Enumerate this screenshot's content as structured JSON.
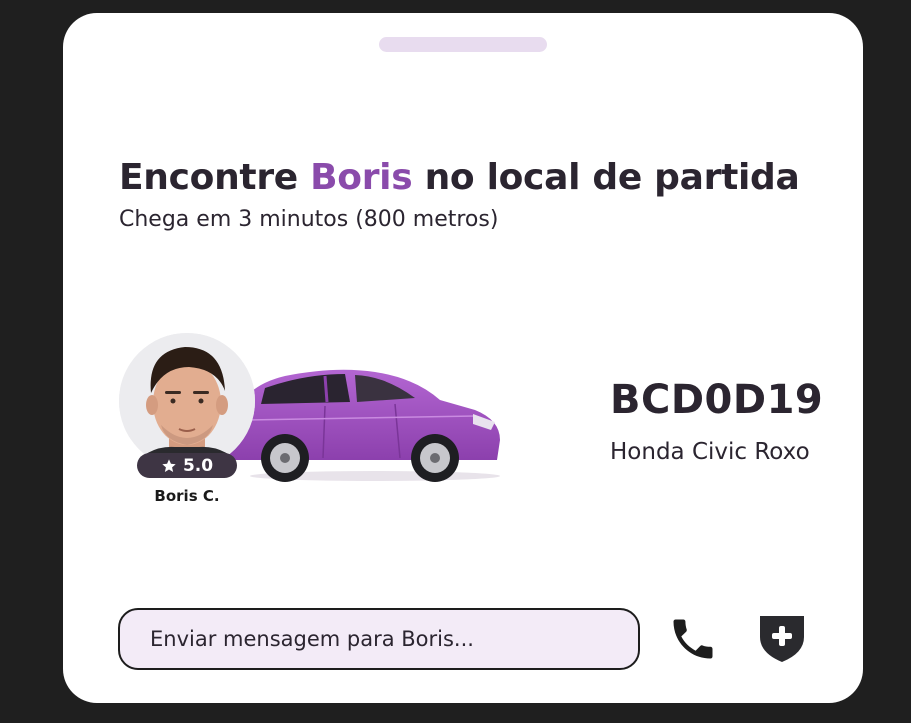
{
  "colors": {
    "accent": "#8a4bab",
    "text": "#2b2530",
    "input_bg": "#f3ebf7",
    "handle": "#e8dcef",
    "car_body": "#9a4fba"
  },
  "header": {
    "title_prefix": "Encontre ",
    "driver_first_name": "Boris",
    "title_suffix": " no local de partida",
    "subtitle": "Chega em 3 minutos (800 metros)"
  },
  "driver": {
    "rating": "5.0",
    "name": "Boris C."
  },
  "vehicle": {
    "plate": "BCD0D19",
    "model": "Honda Civic Roxo"
  },
  "message": {
    "placeholder": "Enviar mensagem para Boris..."
  },
  "icons": {
    "call": "phone-icon",
    "safety": "shield-plus-icon",
    "rating": "star-icon"
  }
}
